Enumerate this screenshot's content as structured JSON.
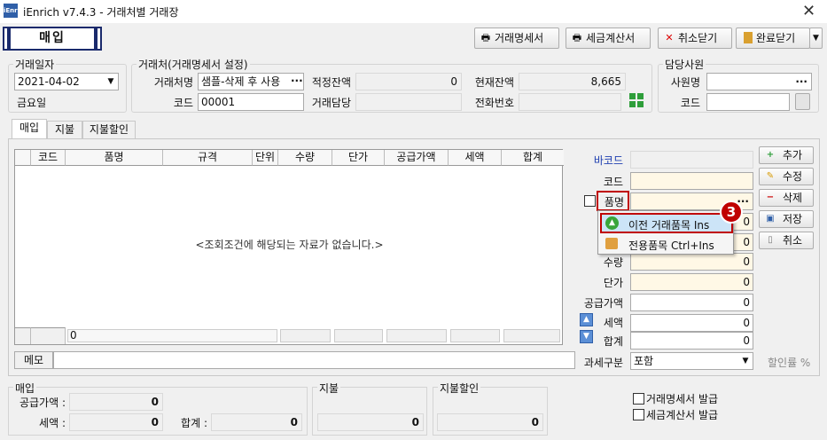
{
  "window": {
    "app_icon": "iEnri",
    "title": "iEnrich v7.4.3 - 거래처별 거래장",
    "close_glyph": "✕"
  },
  "mode_label": "매입",
  "toolbar": {
    "statement": "거래명세서",
    "tax_invoice": "세금계산서",
    "cancel_close": "취소닫기",
    "done_close": "완료닫기"
  },
  "date_group": {
    "label": "거래일자",
    "date": "2021-04-02",
    "weekday": "금요일"
  },
  "partner": {
    "label": "거래처(거래명세서 설정)",
    "name_label": "거래처명",
    "name_value": "샘플-삭제 후 사용",
    "code_label": "코드",
    "code_value": "00001",
    "proper_balance_label": "적정잔액",
    "proper_balance": "0",
    "current_balance_label": "현재잔액",
    "current_balance": "8,665",
    "contact_label": "거래담당",
    "phone_label": "전화번호"
  },
  "staff": {
    "label": "담당사원",
    "name_label": "사원명",
    "code_label": "코드"
  },
  "tabs": [
    "매입",
    "지불",
    "지불할인"
  ],
  "grid": {
    "columns": [
      "코드",
      "품명",
      "규격",
      "단위",
      "수량",
      "단가",
      "공급가액",
      "세액",
      "합계"
    ],
    "empty_message": "<조회조건에 해당되는 자료가 없습니다.>",
    "footer_count": "0"
  },
  "form": {
    "barcode_label": "바코드",
    "code_label": "코드",
    "item_name_label": "품명",
    "qty_label": "수량",
    "unit_price_label": "단가",
    "supply_label": "공급가액",
    "tax_label": "세액",
    "total_label": "합계",
    "qty": "0",
    "unit_price": "0",
    "supply": "0",
    "tax": "0",
    "total": "0",
    "hidden_val_1": "0",
    "hidden_val_2": "0",
    "tax_type_label": "과세구분",
    "tax_type_value": "포함",
    "discount_rate_label": "할인률 %"
  },
  "side_buttons": {
    "add": "추가",
    "edit": "수정",
    "delete": "삭제",
    "save": "저장",
    "cancel": "취소"
  },
  "context_menu": {
    "item1": "이전 거래품목 Ins",
    "item2": "전용품목 Ctrl+Ins",
    "badge": "3"
  },
  "memo_label": "메모",
  "summary": {
    "purchase_label": "매입",
    "supply_label": "공급가액 :",
    "supply": "0",
    "tax_label": "세액 :",
    "tax": "0",
    "total_label": "합계 :",
    "total": "0",
    "payment_label": "지불",
    "payment": "0",
    "payment_discount_label": "지불할인",
    "payment_discount": "0"
  },
  "options": {
    "issue_statement": "거래명세서 발급",
    "issue_tax_invoice": "세금계산서 발급"
  },
  "colors": {
    "accent": "#c00000",
    "barcode_label": "#1f3fb0",
    "highlight": "#cce4f7"
  }
}
